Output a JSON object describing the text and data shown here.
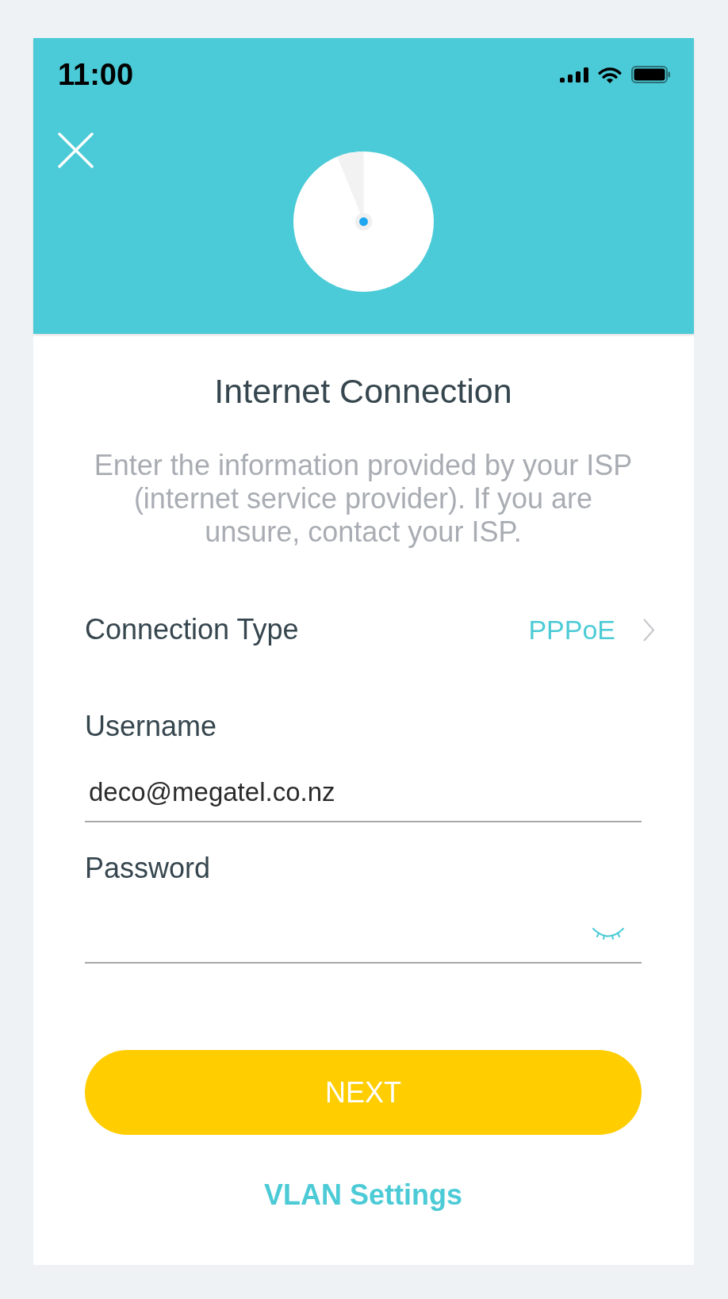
{
  "status_bar": {
    "time": "11:00"
  },
  "title": "Internet Connection",
  "description": "Enter the information provided by your ISP (internet service provider). If you are unsure, contact your ISP.",
  "connection_type": {
    "label": "Connection Type",
    "value": "PPPoE"
  },
  "fields": [
    {
      "kind": "text",
      "label": "Username",
      "value": "deco@megatel.co.nz"
    },
    {
      "kind": "password",
      "label": "Password"
    }
  ],
  "primary_button": {
    "label": "NEXT"
  },
  "link": {
    "label": "VLAN Settings"
  }
}
